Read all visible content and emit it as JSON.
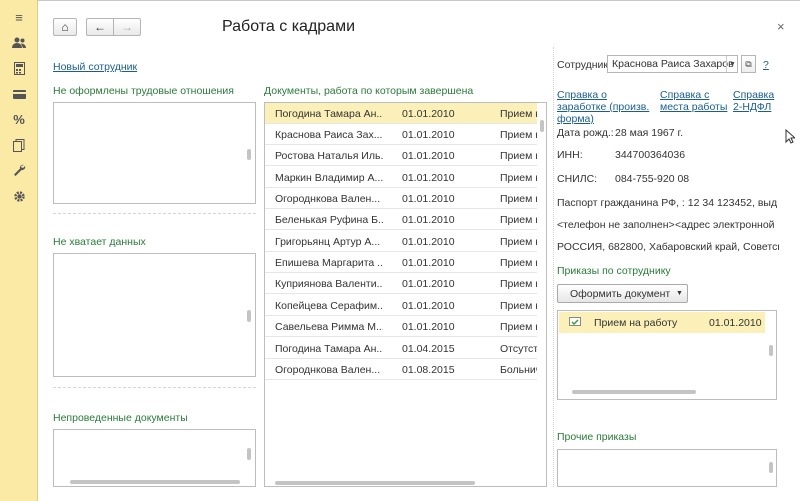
{
  "window": {
    "title": "Работа с кадрами",
    "close": "×"
  },
  "toolbar": {
    "home": "⌂",
    "back": "←",
    "forward": "→"
  },
  "sidebar": {
    "items": [
      "menu-icon",
      "users-icon",
      "calculator-icon",
      "card-icon",
      "percent-icon",
      "docs-icon",
      "wrench-icon",
      "gear-icon"
    ]
  },
  "left": {
    "new_employee": "Новый сотрудник",
    "section1": "Не оформлены трудовые отношения",
    "section2": "Не хватает данных",
    "section3": "Непроведенные документы"
  },
  "middle": {
    "title": "Документы, работа по которым завершена",
    "rows": [
      {
        "name": "Погодина Тамара Ан...",
        "date": "01.01.2010",
        "doc": "Прием н"
      },
      {
        "name": "Краснова Раиса Зах...",
        "date": "01.01.2010",
        "doc": "Прием н"
      },
      {
        "name": "Ростова Наталья Иль...",
        "date": "01.01.2010",
        "doc": "Прием н"
      },
      {
        "name": "Маркин Владимир А...",
        "date": "01.01.2010",
        "doc": "Прием н"
      },
      {
        "name": "Огороднкова Вален...",
        "date": "01.01.2010",
        "doc": "Прием н"
      },
      {
        "name": "Беленькая Руфина Б...",
        "date": "01.01.2010",
        "doc": "Прием н"
      },
      {
        "name": "Григорьянц Артур А...",
        "date": "01.01.2010",
        "doc": "Прием н"
      },
      {
        "name": "Епишева Маргарита ...",
        "date": "01.01.2010",
        "doc": "Прием н"
      },
      {
        "name": "Куприянова Валенти...",
        "date": "01.01.2010",
        "doc": "Прием н"
      },
      {
        "name": "Копейцева Серафим...",
        "date": "01.01.2010",
        "doc": "Прием н"
      },
      {
        "name": "Савельева Римма М...",
        "date": "01.01.2010",
        "doc": "Прием н"
      },
      {
        "name": "Погодина Тамара Ан...",
        "date": "01.04.2015",
        "doc": "Отсутст"
      },
      {
        "name": "Огороднкова Вален...",
        "date": "01.08.2015",
        "doc": "Больнич"
      }
    ]
  },
  "right": {
    "employee_label": "Сотрудник:",
    "employee_value": "Краснова Раиса Захаров",
    "help": "?",
    "links": [
      "Справка о заработке (произв. форма)",
      "Справка с места работы",
      "Справка 2-НДФЛ"
    ],
    "birth_label": "Дата рожд.:",
    "birth_value": "28 мая 1967 г.",
    "inn_label": "ИНН:",
    "inn_value": "344700364036",
    "snils_label": "СНИЛС:",
    "snils_value": "084-755-920 08",
    "passport": "Паспорт гражданина РФ, : 12 34 123452, выдан...",
    "phone": "<телефон не заполнен>",
    "email": "<адрес электронной ...",
    "address": "РОССИЯ, 682800, Хабаровский край, Советская...",
    "orders_title": "Приказы по сотруднику",
    "make_doc": "Оформить документ",
    "order_name": "Прием на работу",
    "order_date": "01.01.2010",
    "other_orders": "Прочие приказы"
  }
}
